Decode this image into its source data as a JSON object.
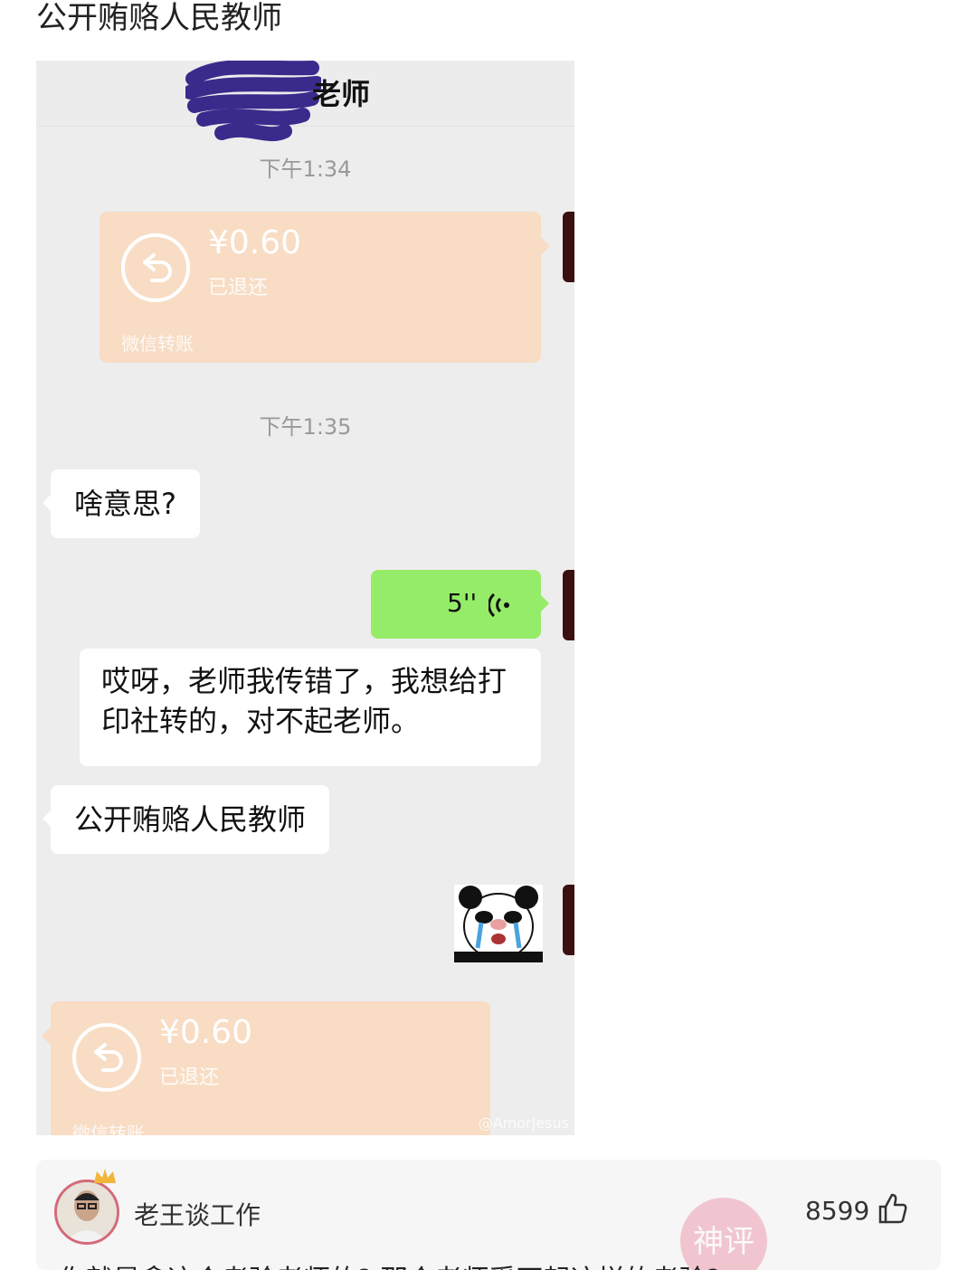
{
  "post": {
    "title": "公开贿赂人民教师"
  },
  "chat": {
    "contact_name": "老师",
    "messages": [
      {
        "type": "time",
        "text": "下午1:34"
      },
      {
        "type": "transfer",
        "side": "right",
        "amount": "¥0.60",
        "status": "已退还",
        "footer": "微信转账"
      },
      {
        "type": "time",
        "text": "下午1:35"
      },
      {
        "type": "text",
        "side": "left",
        "text": "啥意思?"
      },
      {
        "type": "voice",
        "side": "right",
        "duration": "5''"
      },
      {
        "type": "text",
        "side": "right",
        "lines": [
          "哎呀，老师我传错了，我想给打",
          "印社转的，对不起老师。"
        ]
      },
      {
        "type": "text",
        "side": "left",
        "text": "公开贿赂人民教师"
      },
      {
        "type": "sticker",
        "side": "right",
        "icon": "crying-panda-sticker"
      },
      {
        "type": "transfer",
        "side": "left",
        "amount": "¥0.60",
        "status": "已退还",
        "footer": "微信转账"
      }
    ],
    "watermark": "@AmorJesus"
  },
  "comment": {
    "author": "老王谈工作",
    "like_count": "8599",
    "text": "你就是拿这个考验老师的? 那个老师受不起这样的考验?",
    "badge": "神评"
  },
  "colors": {
    "transfer_bg": "#f8dcc4",
    "voice_bg": "#95ec69",
    "chat_bg": "#ededed"
  }
}
